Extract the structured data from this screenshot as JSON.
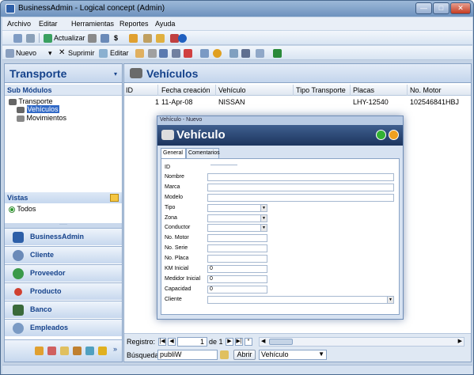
{
  "window": {
    "title": "BusinessAdmin - Logical concept (Admin)"
  },
  "menu": [
    "Archivo",
    "Editar",
    "Herramientas",
    "Reportes",
    "Ayuda"
  ],
  "toolbar1": {
    "actualizar": "Actualizar"
  },
  "toolbar2": {
    "nuevo": "Nuevo",
    "suprimir": "Suprimir",
    "editar": "Editar"
  },
  "left": {
    "title": "Transporte",
    "submodulos": "Sub Módulos",
    "tree": {
      "root": "Transporte",
      "vehiculos": "Vehículos",
      "movimientos": "Movimientos"
    },
    "vistas": "Vistas",
    "todos": "Todos",
    "nav": [
      "BusinessAdmin",
      "Cliente",
      "Proveedor",
      "Producto",
      "Banco",
      "Empleados"
    ]
  },
  "main": {
    "title": "Vehículos",
    "columns": [
      "ID",
      "Fecha creación",
      "Vehículo",
      "Tipo Transporte",
      "Placas",
      "No. Motor"
    ],
    "rows": [
      {
        "id": "1",
        "fecha": "11-Apr-08",
        "vehiculo": "NISSAN",
        "tipo": "",
        "placas": "LHY-12540",
        "motor": "102546841HBJ"
      }
    ]
  },
  "bottom": {
    "registro": "Registro:",
    "page": "1",
    "of": "de 1",
    "busqueda": "Búsqueda",
    "search_value": "publiW",
    "abrir": "Abrir",
    "combo": "Vehículo"
  },
  "dialog": {
    "window_title": "Vehículo - Nuevo",
    "title": "Vehículo",
    "tabs": [
      "General",
      "Comentarios"
    ],
    "labels": [
      "ID",
      "Nombre",
      "Marca",
      "Modelo",
      "Tipo",
      "Zona",
      "Conductor",
      "No. Motor",
      "No. Serie",
      "No. Placa",
      "KM Inicial",
      "Medidor Inicial",
      "Capacidad",
      "Cliente"
    ],
    "km_inicial": "0",
    "medidor_inicial": "0",
    "capacidad": "0"
  }
}
